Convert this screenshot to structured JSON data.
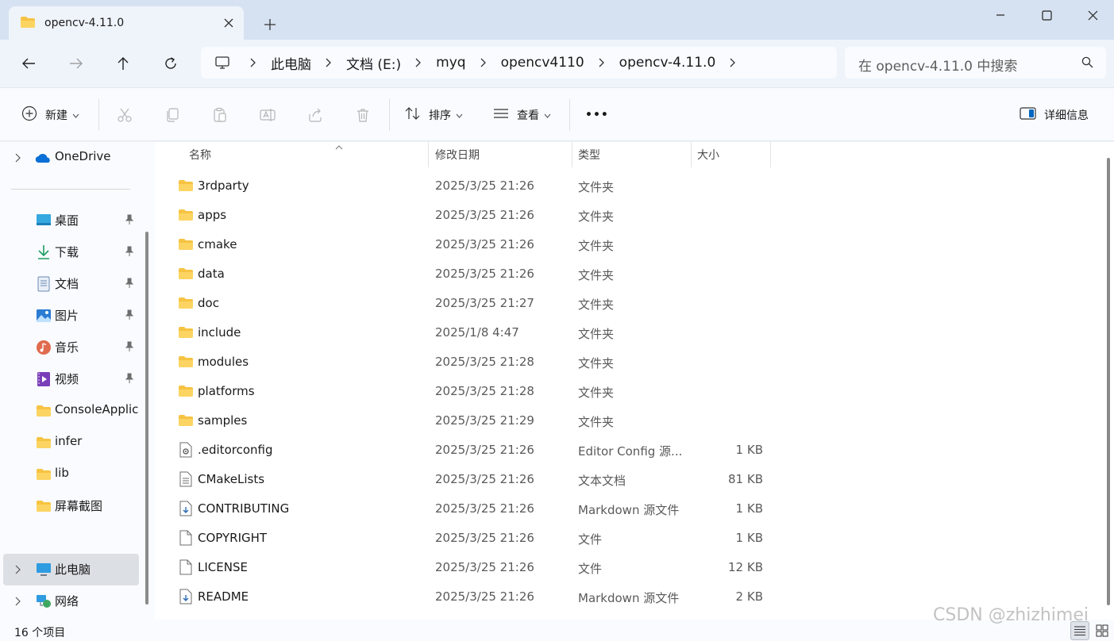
{
  "window": {
    "tab_title": "opencv-4.11.0",
    "new_tab_symbol": "+"
  },
  "nav": {
    "breadcrumbs": [
      "此电脑",
      "文档 (E:)",
      "myq",
      "opencv4110",
      "opencv-4.11.0"
    ],
    "search_placeholder": "在 opencv-4.11.0 中搜索"
  },
  "toolbar": {
    "new_label": "新建",
    "sort_label": "排序",
    "view_label": "查看",
    "more_label": "•••",
    "details_label": "详细信息"
  },
  "sidebar": {
    "onedrive": "OneDrive",
    "quick_access": [
      {
        "label": "桌面",
        "icon": "desktop-icon",
        "pinned": true
      },
      {
        "label": "下载",
        "icon": "download-icon",
        "pinned": true
      },
      {
        "label": "文档",
        "icon": "documents-icon",
        "pinned": true
      },
      {
        "label": "图片",
        "icon": "pictures-icon",
        "pinned": true
      },
      {
        "label": "音乐",
        "icon": "music-icon",
        "pinned": true
      },
      {
        "label": "视频",
        "icon": "videos-icon",
        "pinned": true
      },
      {
        "label": "ConsoleApplication",
        "icon": "folder-icon",
        "pinned": false
      },
      {
        "label": "infer",
        "icon": "folder-icon",
        "pinned": false
      },
      {
        "label": "lib",
        "icon": "folder-icon",
        "pinned": false
      },
      {
        "label": "屏幕截图",
        "icon": "folder-icon",
        "pinned": false
      }
    ],
    "this_pc": "此电脑",
    "network": "网络"
  },
  "columns": {
    "name": "名称",
    "date": "修改日期",
    "type": "类型",
    "size": "大小"
  },
  "files": [
    {
      "name": "3rdparty",
      "date": "2025/3/25 21:26",
      "type": "文件夹",
      "size": "",
      "icon": "folder-icon"
    },
    {
      "name": "apps",
      "date": "2025/3/25 21:26",
      "type": "文件夹",
      "size": "",
      "icon": "folder-icon"
    },
    {
      "name": "cmake",
      "date": "2025/3/25 21:26",
      "type": "文件夹",
      "size": "",
      "icon": "folder-icon"
    },
    {
      "name": "data",
      "date": "2025/3/25 21:26",
      "type": "文件夹",
      "size": "",
      "icon": "folder-icon"
    },
    {
      "name": "doc",
      "date": "2025/3/25 21:27",
      "type": "文件夹",
      "size": "",
      "icon": "folder-icon"
    },
    {
      "name": "include",
      "date": "2025/1/8 4:47",
      "type": "文件夹",
      "size": "",
      "icon": "folder-icon"
    },
    {
      "name": "modules",
      "date": "2025/3/25 21:28",
      "type": "文件夹",
      "size": "",
      "icon": "folder-icon"
    },
    {
      "name": "platforms",
      "date": "2025/3/25 21:28",
      "type": "文件夹",
      "size": "",
      "icon": "folder-icon"
    },
    {
      "name": "samples",
      "date": "2025/3/25 21:29",
      "type": "文件夹",
      "size": "",
      "icon": "folder-icon"
    },
    {
      "name": ".editorconfig",
      "date": "2025/3/25 21:26",
      "type": "Editor Config 源...",
      "size": "1 KB",
      "icon": "config-file-icon"
    },
    {
      "name": "CMakeLists",
      "date": "2025/3/25 21:26",
      "type": "文本文档",
      "size": "81 KB",
      "icon": "text-file-icon"
    },
    {
      "name": "CONTRIBUTING",
      "date": "2025/3/25 21:26",
      "type": "Markdown 源文件",
      "size": "1 KB",
      "icon": "markdown-file-icon"
    },
    {
      "name": "COPYRIGHT",
      "date": "2025/3/25 21:26",
      "type": "文件",
      "size": "1 KB",
      "icon": "blank-file-icon"
    },
    {
      "name": "LICENSE",
      "date": "2025/3/25 21:26",
      "type": "文件",
      "size": "12 KB",
      "icon": "blank-file-icon"
    },
    {
      "name": "README",
      "date": "2025/3/25 21:26",
      "type": "Markdown 源文件",
      "size": "2 KB",
      "icon": "markdown-file-icon"
    }
  ],
  "status": {
    "item_count": "16 个项目"
  },
  "watermark": "CSDN @zhizhimei",
  "colors": {
    "accent": "#0067c0",
    "folder": "#f6c342",
    "titlebar": "#d6e2f1"
  }
}
